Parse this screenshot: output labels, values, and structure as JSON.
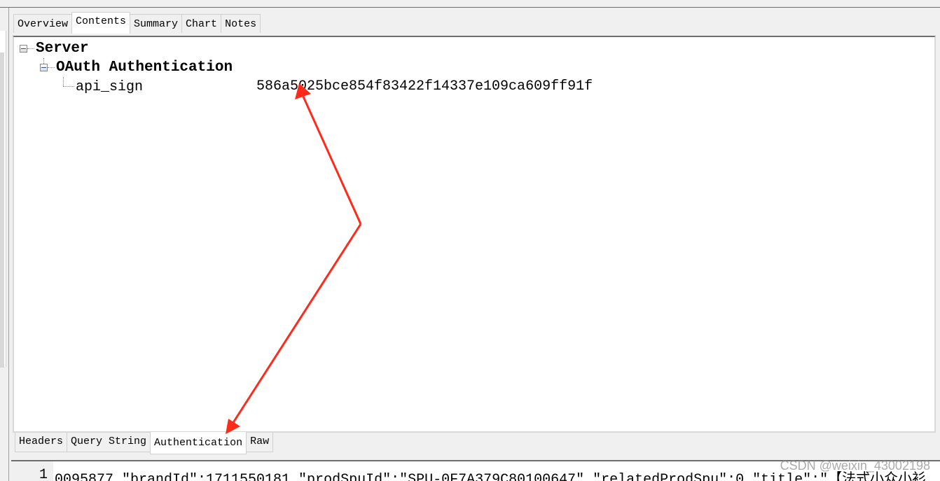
{
  "top_tabs": [
    {
      "label": "Overview"
    },
    {
      "label": "Contents",
      "active": true
    },
    {
      "label": "Summary"
    },
    {
      "label": "Chart"
    },
    {
      "label": "Notes"
    }
  ],
  "tree": {
    "root": "Server",
    "child": "OAuth Authentication",
    "leaf": {
      "key": "api_sign",
      "value": "586a5025bce854f83422f14337e109ca609ff91f"
    }
  },
  "bottom_tabs": [
    {
      "label": "Headers"
    },
    {
      "label": "Query String"
    },
    {
      "label": "Authentication",
      "active": true
    },
    {
      "label": "Raw"
    }
  ],
  "code": {
    "line_number": "1",
    "text": "0095877,\"brandId\":1711550181,\"prodSpuId\":\"SPU-0F7A379C80100647\",\"relatedProdSpu\":0,\"title\":\"【法式小众小衫"
  },
  "watermark": "CSDN @weixin_43002198",
  "colors": {
    "arrow": "#ff2a1a",
    "tree_line": "#888888"
  }
}
